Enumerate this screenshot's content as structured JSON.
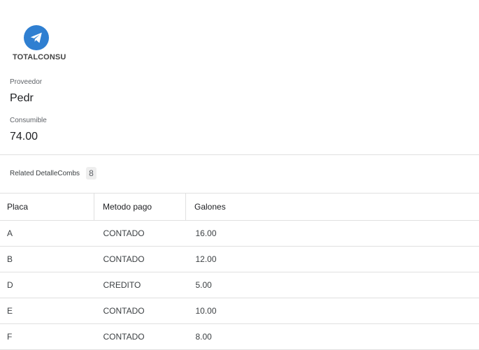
{
  "app": {
    "title": "TOTALCONSU",
    "icon": "telegram-send-icon",
    "accent_color": "#2f7fd1"
  },
  "record": {
    "proveedor_label": "Proveedor",
    "proveedor_value": "Pedr",
    "consumible_label": "Consumible",
    "consumible_value": "74.00"
  },
  "related": {
    "label": "Related DetalleCombs",
    "count": "8"
  },
  "table": {
    "headers": [
      "Placa",
      "Metodo pago",
      "Galones"
    ],
    "rows": [
      [
        "A",
        "CONTADO",
        "16.00"
      ],
      [
        "B",
        "CONTADO",
        "12.00"
      ],
      [
        "D",
        "CREDITO",
        "5.00"
      ],
      [
        "E",
        "CONTADO",
        "10.00"
      ],
      [
        "F",
        "CONTADO",
        "8.00"
      ]
    ]
  }
}
